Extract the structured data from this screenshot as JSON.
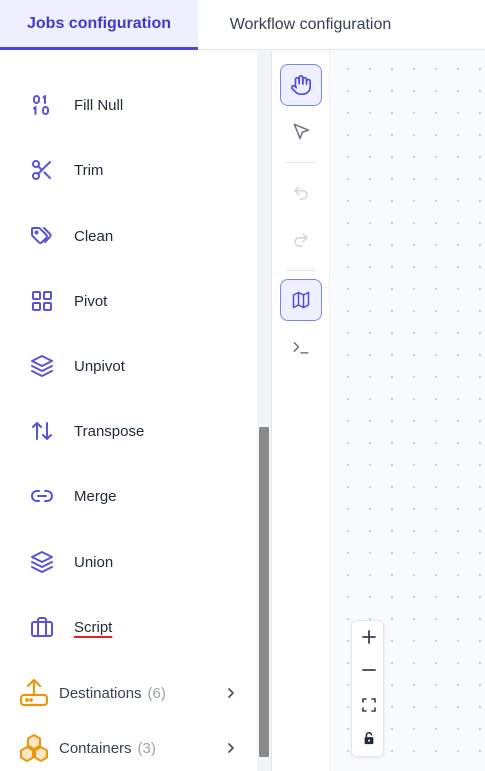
{
  "tabs": {
    "jobs": "Jobs configuration",
    "workflow": "Workflow configuration"
  },
  "sidebar": {
    "items": [
      {
        "label": "Fill Null",
        "icon": "fill-null-icon"
      },
      {
        "label": "Trim",
        "icon": "scissors-icon"
      },
      {
        "label": "Clean",
        "icon": "tags-icon"
      },
      {
        "label": "Pivot",
        "icon": "grid-icon"
      },
      {
        "label": "Unpivot",
        "icon": "layers-icon"
      },
      {
        "label": "Transpose",
        "icon": "arrows-up-down-icon"
      },
      {
        "label": "Merge",
        "icon": "link-icon"
      },
      {
        "label": "Union",
        "icon": "layers-icon"
      },
      {
        "label": "Script",
        "icon": "briefcase-icon"
      }
    ],
    "groups": [
      {
        "label": "Destinations",
        "count": "(6)",
        "icon": "upload-icon"
      },
      {
        "label": "Containers",
        "count": "(3)",
        "icon": "boxes-icon"
      }
    ]
  },
  "toolbar": [
    "hand-icon",
    "pointer-icon",
    "undo-icon",
    "redo-icon",
    "map-icon",
    "terminal-icon"
  ],
  "zoom": [
    "zoom-in-icon",
    "zoom-out-icon",
    "fit-view-icon",
    "lock-icon"
  ],
  "colors": {
    "accent": "#4f46e5",
    "icon": "#5b52d6",
    "orange": "#e8970f"
  }
}
